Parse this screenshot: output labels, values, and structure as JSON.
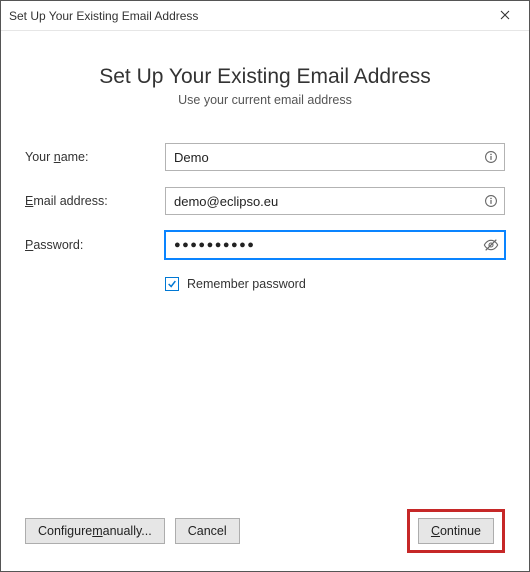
{
  "window": {
    "title": "Set Up Your Existing Email Address"
  },
  "header": {
    "heading": "Set Up Your Existing Email Address",
    "subheading": "Use your current email address"
  },
  "form": {
    "name_label_pre": "Your ",
    "name_label_u": "n",
    "name_label_post": "ame:",
    "name_value": "Demo",
    "email_label_pre": "",
    "email_label_u": "E",
    "email_label_post": "mail address:",
    "email_value": "demo@eclipso.eu",
    "password_label_pre": "",
    "password_label_u": "P",
    "password_label_post": "assword:",
    "password_masked": "●●●●●●●●●●",
    "remember_label": "Remember password",
    "remember_checked": true
  },
  "buttons": {
    "configure_pre": "Configure ",
    "configure_u": "m",
    "configure_post": "anually...",
    "cancel": "Cancel",
    "continue_u": "C",
    "continue_post": "ontinue"
  }
}
